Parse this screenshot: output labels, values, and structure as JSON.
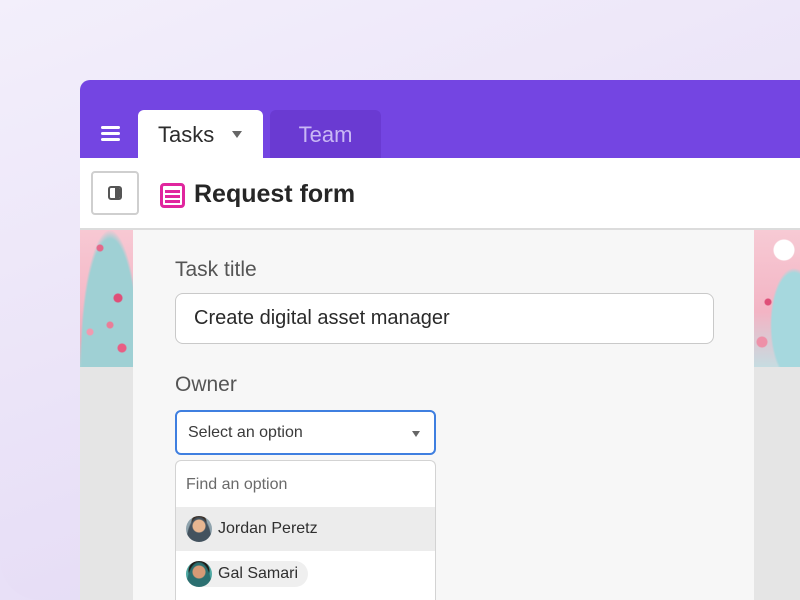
{
  "tabs": [
    {
      "label": "Tasks",
      "active": true
    },
    {
      "label": "Team",
      "active": false
    }
  ],
  "header": {
    "title": "Request form",
    "icon": "form-icon"
  },
  "form": {
    "task_title": {
      "label": "Task title",
      "value": "Create digital asset manager"
    },
    "owner": {
      "label": "Owner",
      "placeholder": "Select an option",
      "search_placeholder": "Find an option",
      "options": [
        {
          "name": "Jordan Peretz",
          "avatar": "avatar-jordan"
        },
        {
          "name": "Gal Samari",
          "avatar": "avatar-gal"
        }
      ]
    }
  },
  "colors": {
    "accent": "#7445e2",
    "form_icon": "#e0269e",
    "focus_border": "#3f7fe0"
  }
}
